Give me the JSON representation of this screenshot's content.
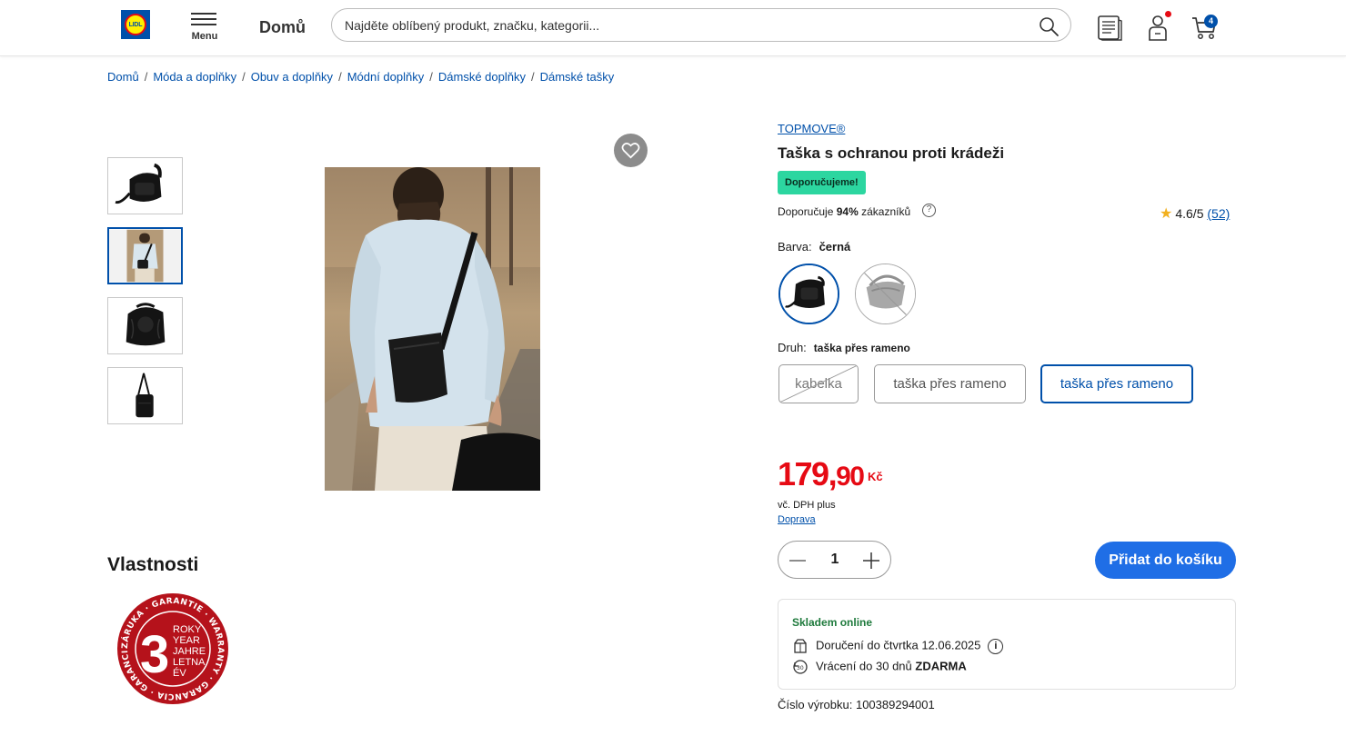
{
  "header": {
    "logo_text": "LIDL",
    "menu_label": "Menu",
    "home_label": "Domů",
    "search_placeholder": "Najděte oblíbený produkt, značku, kategorii...",
    "cart_count": "4",
    "icons": [
      "search-icon",
      "leaflet-icon",
      "user-icon",
      "cart-icon"
    ]
  },
  "breadcrumb": [
    "Domů",
    "Móda a doplňky",
    "Obuv a doplňky",
    "Módní doplňky",
    "Dámské doplňky",
    "Dámské tašky"
  ],
  "gallery": {
    "thumbnails": [
      "bag-front",
      "model-wearing-bag",
      "bag-top",
      "bag-side"
    ],
    "active_index": 1
  },
  "product": {
    "brand": "TOPMOVE®",
    "title": "Taška s ochranou proti krádeži",
    "badge": "Doporučujeme!",
    "recommend_prefix": "Doporučuje",
    "recommend_percent": "94%",
    "recommend_suffix": "zákazníků",
    "rating": "4.6/5",
    "rating_count": "(52)",
    "color_label": "Barva:",
    "color_value": "černá",
    "colors": [
      "černá",
      "šedá"
    ],
    "type_label": "Druh:",
    "type_value": "taška přes rameno",
    "types": [
      {
        "label": "kabelka",
        "state": "unavailable"
      },
      {
        "label": "taška přes rameno",
        "state": "default"
      },
      {
        "label": "taška přes rameno",
        "state": "selected"
      }
    ],
    "price_main": "179,",
    "price_dec": "90",
    "currency": "Kč",
    "vat": "vč. DPH plus",
    "shipping": "Doprava",
    "quantity": "1",
    "add_to_cart": "Přidat do košíku",
    "stock_title": "Skladem online",
    "delivery": "Doručení do čtvrtka 12.06.2025",
    "return_prefix": "Vrácení do 30 dnů",
    "return_bold": "ZDARMA",
    "product_no": "Číslo výrobku: 100389294001"
  },
  "properties": {
    "title": "Vlastnosti",
    "warranty": {
      "number": "3",
      "lines": [
        "ROKY",
        "YEAR",
        "JAHRE",
        "LETNA",
        "ÉV"
      ],
      "ring_text": "ZÁRUKA · GARANTIE · WARRANTY · GARANCIA · GARANCIJA ·"
    }
  },
  "colors": {
    "accent": "#0050aa",
    "price": "#e60a14",
    "button": "#1f6ee6",
    "badge": "#2cd6a0",
    "stock": "#1e7a3c"
  }
}
